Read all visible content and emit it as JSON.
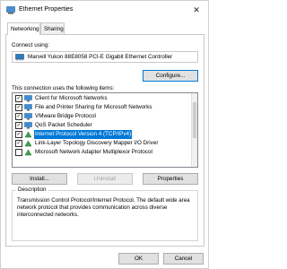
{
  "window": {
    "title": "Ethernet Properties"
  },
  "tabs": [
    {
      "label": "Networking",
      "active": true
    },
    {
      "label": "Sharing",
      "active": false
    }
  ],
  "connect_using": {
    "label": "Connect using:",
    "adapter": "Marvell Yukon 88E8058 PCI-E Gigabit Ethernet Controller"
  },
  "configure_button": "Configure...",
  "items_label": "This connection uses the following items:",
  "items": [
    {
      "label": "Client for Microsoft Networks",
      "checked": true,
      "selected": false,
      "icon": "network-client-icon"
    },
    {
      "label": "File and Printer Sharing for Microsoft Networks",
      "checked": true,
      "selected": false,
      "icon": "network-service-icon"
    },
    {
      "label": "VMware Bridge Protocol",
      "checked": true,
      "selected": false,
      "icon": "network-protocol-icon"
    },
    {
      "label": "QoS Packet Scheduler",
      "checked": true,
      "selected": false,
      "icon": "network-service-icon"
    },
    {
      "label": "Internet Protocol Version 4 (TCP/IPv4)",
      "checked": true,
      "selected": true,
      "icon": "network-protocol-icon"
    },
    {
      "label": "Link-Layer Topology Discovery Mapper I/O Driver",
      "checked": true,
      "selected": false,
      "icon": "network-protocol-icon"
    },
    {
      "label": "Microsoft Network Adapter Multiplexor Protocol",
      "checked": false,
      "selected": false,
      "icon": "network-protocol-icon"
    }
  ],
  "buttons": {
    "install": "Install...",
    "uninstall": "Uninstall",
    "properties": "Properties",
    "ok": "OK",
    "cancel": "Cancel"
  },
  "description": {
    "title": "Description",
    "text": "Transmission Control Protocol/Internet Protocol. The default wide area network protocol that provides communication across diverse interconnected networks."
  },
  "colors": {
    "selection": "#0078d7",
    "adapter_icon": "#2f7bbf"
  }
}
